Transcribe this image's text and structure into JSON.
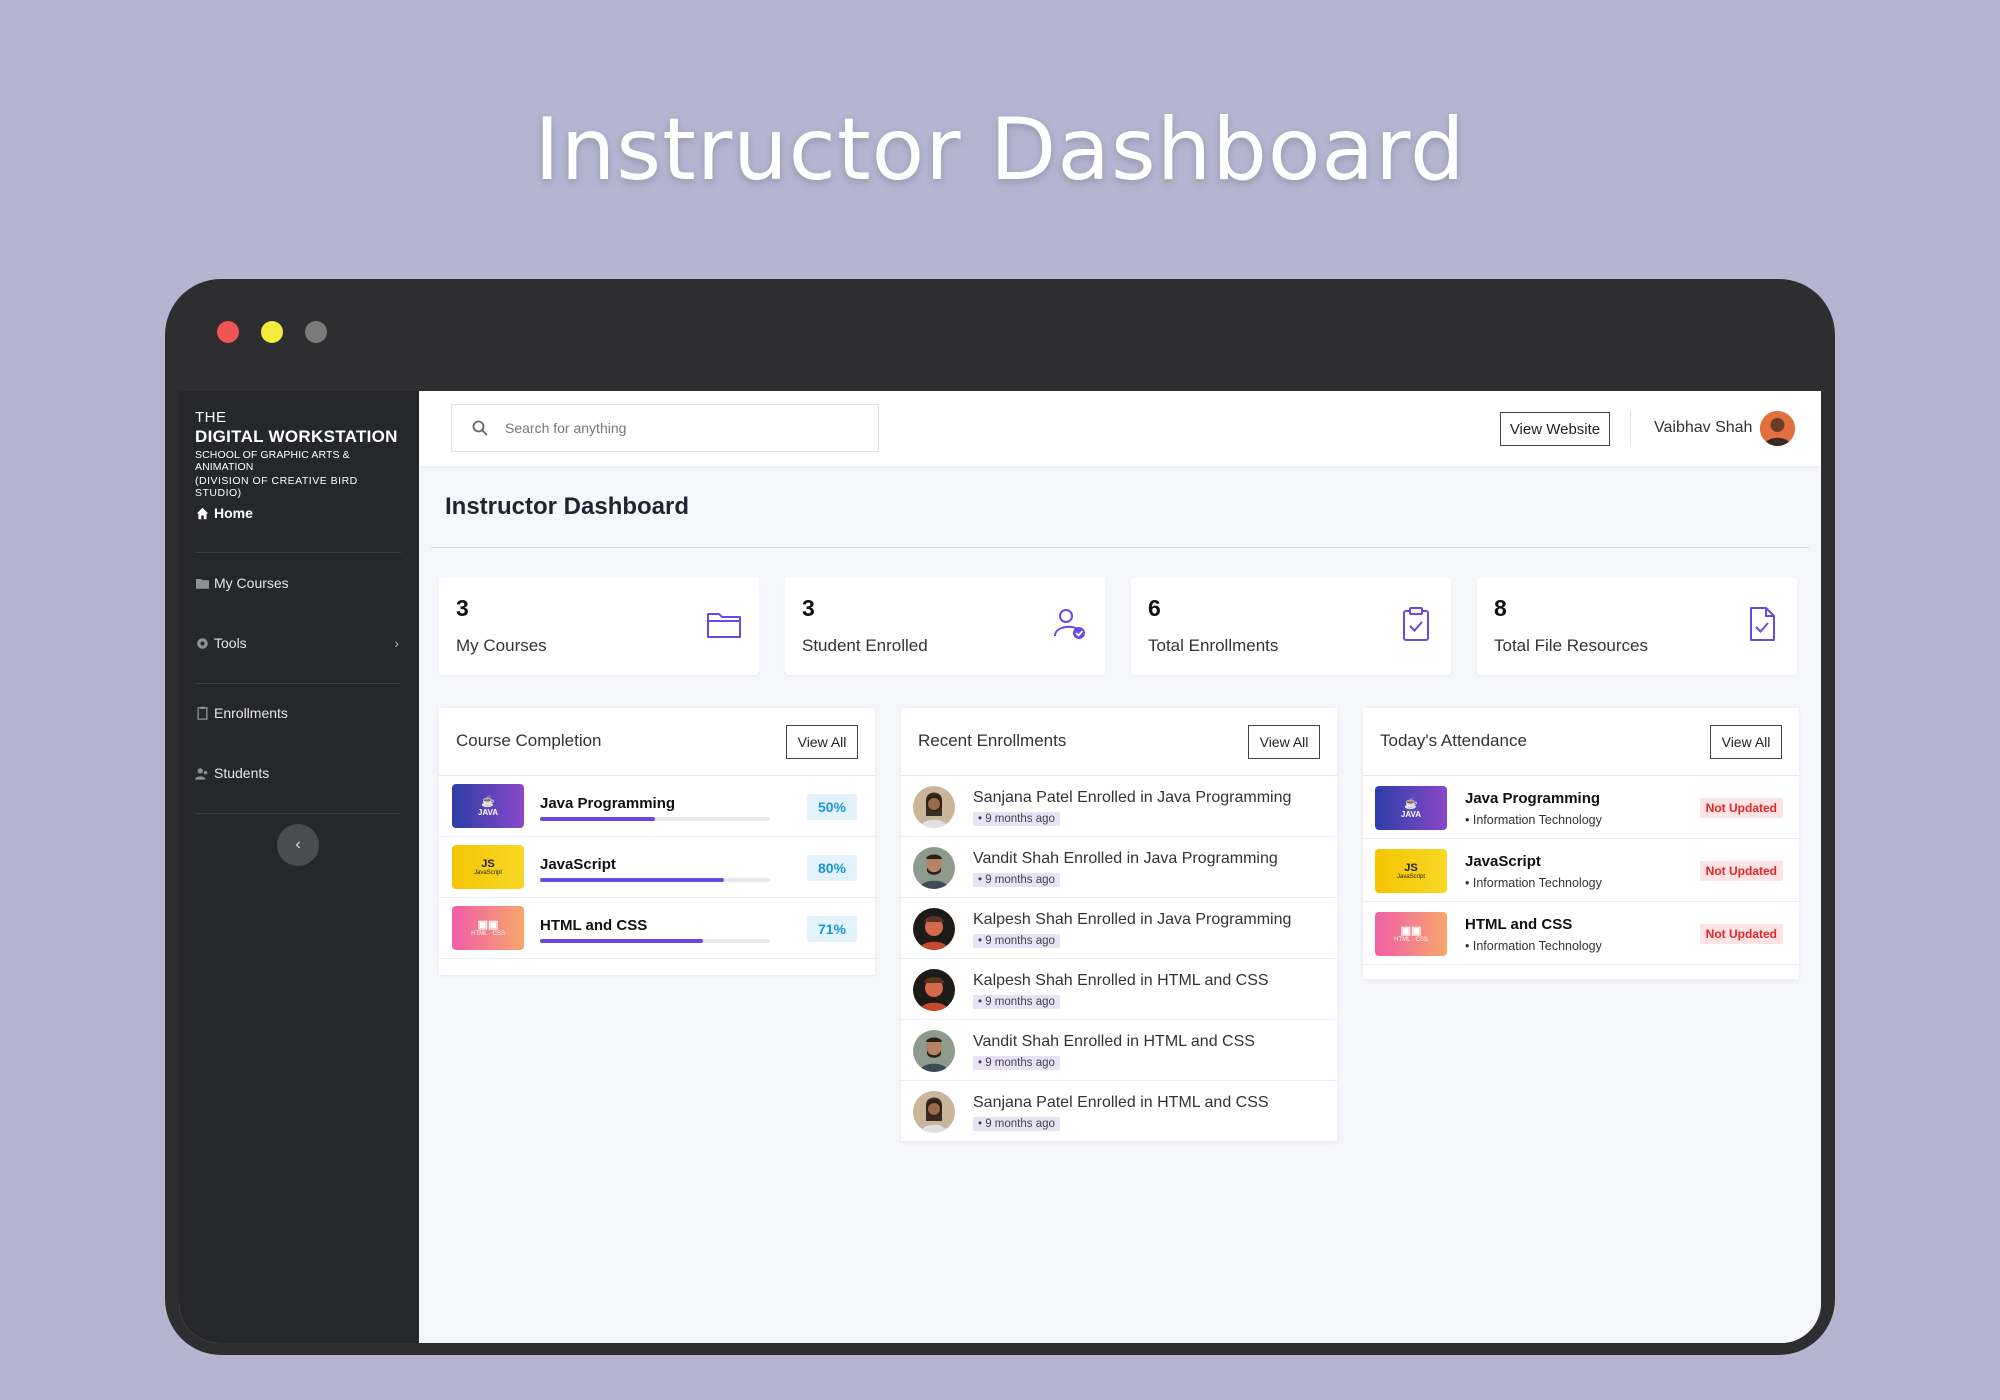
{
  "hero": {
    "title": "Instructor Dashboard"
  },
  "brand": {
    "the": "THE",
    "name": "DIGITAL WORKSTATION",
    "subtitle": "SCHOOL OF GRAPHIC ARTS & ANIMATION",
    "division": "(DIVISION OF CREATIVE BIRD STUDIO)"
  },
  "sidebar": {
    "items": [
      {
        "label": "Home",
        "icon": "home-icon"
      },
      {
        "label": "My Courses",
        "icon": "folder-icon"
      },
      {
        "label": "Tools",
        "icon": "gear-icon"
      },
      {
        "label": "Enrollments",
        "icon": "clipboard-icon"
      },
      {
        "label": "Students",
        "icon": "users-icon"
      }
    ]
  },
  "topbar": {
    "search_placeholder": "Search for anything",
    "view_website": "View Website",
    "user_name": "Vaibhav Shah"
  },
  "page": {
    "title": "Instructor Dashboard"
  },
  "stats": [
    {
      "value": "3",
      "label": "My Courses",
      "icon": "folder-icon"
    },
    {
      "value": "3",
      "label": "Student Enrolled",
      "icon": "user-check-icon"
    },
    {
      "value": "6",
      "label": "Total Enrollments",
      "icon": "clipboard-check-icon"
    },
    {
      "value": "8",
      "label": "Total File Resources",
      "icon": "file-check-icon"
    }
  ],
  "course_completion": {
    "title": "Course Completion",
    "view_all": "View All",
    "courses": [
      {
        "name": "Java Programming",
        "percent_label": "50%",
        "progress": 0.5,
        "thumb_text": "JAVA"
      },
      {
        "name": "JavaScript",
        "percent_label": "80%",
        "progress": 0.8,
        "thumb_text": "JavaScript",
        "thumb_glyph": "JS"
      },
      {
        "name": "HTML and CSS",
        "percent_label": "71%",
        "progress": 0.71,
        "thumb_text": "HTML · CSS"
      }
    ]
  },
  "recent_enrollments": {
    "title": "Recent Enrollments",
    "view_all": "View All",
    "items": [
      {
        "text": "Sanjana Patel Enrolled in Java Programming",
        "time": "• 9 months ago"
      },
      {
        "text": "Vandit Shah Enrolled in Java Programming",
        "time": "• 9 months ago"
      },
      {
        "text": "Kalpesh Shah Enrolled in Java Programming",
        "time": "• 9 months ago"
      },
      {
        "text": "Kalpesh Shah Enrolled in HTML and CSS",
        "time": "• 9 months ago"
      },
      {
        "text": "Vandit Shah Enrolled in HTML and CSS",
        "time": "• 9 months ago"
      },
      {
        "text": "Sanjana Patel Enrolled in HTML and CSS",
        "time": "• 9 months ago"
      }
    ]
  },
  "attendance": {
    "title": "Today's Attendance",
    "view_all": "View All",
    "items": [
      {
        "name": "Java Programming",
        "dept": "• Information Technology",
        "status": "Not Updated"
      },
      {
        "name": "JavaScript",
        "dept": "• Information Technology",
        "status": "Not Updated"
      },
      {
        "name": "HTML and CSS",
        "dept": "• Information Technology",
        "status": "Not Updated"
      }
    ]
  },
  "colors": {
    "accent": "#6a48e8",
    "percent_text": "#1c95d6",
    "status_red": "#e0262a",
    "sidebar_bg": "#25272b"
  }
}
